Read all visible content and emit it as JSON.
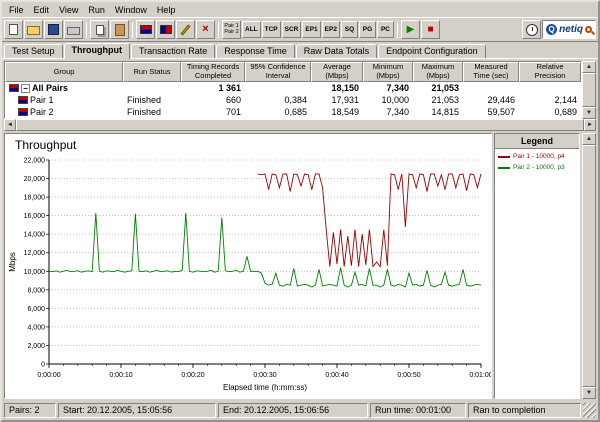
{
  "menubar": {
    "items": [
      "File",
      "Edit",
      "View",
      "Run",
      "Window",
      "Help"
    ]
  },
  "toolbar": {
    "filter_buttons": [
      "ALL",
      "TCP",
      "SCR",
      "EP1",
      "EP2",
      "SQ",
      "PG",
      "PC"
    ],
    "pair_buttons": [
      "Pair 1",
      "Pair 2"
    ],
    "logo_text": "netiq"
  },
  "tabs": {
    "items": [
      "Test Setup",
      "Throughput",
      "Transaction Rate",
      "Response Time",
      "Raw Data Totals",
      "Endpoint Configuration"
    ],
    "active": "Throughput"
  },
  "table": {
    "columns": [
      "Group",
      "Run Status",
      "Timing Records\nCompleted",
      "95% Confidence\nInterval",
      "Average\n(Mbps)",
      "Minimum\n(Mbps)",
      "Maximum\n(Mbps)",
      "Measured\nTime (sec)",
      "Relative\nPrecision"
    ],
    "rows": [
      {
        "group": "All Pairs",
        "status": "",
        "records": "1 361",
        "ci": "",
        "avg": "18,150",
        "min": "7,340",
        "max": "21,053",
        "time": "",
        "prec": ""
      },
      {
        "group": "Pair 1",
        "status": "Finished",
        "records": "660",
        "ci": "0,384",
        "avg": "17,931",
        "min": "10,000",
        "max": "21,053",
        "time": "29,446",
        "prec": "2,144"
      },
      {
        "group": "Pair 2",
        "status": "Finished",
        "records": "701",
        "ci": "0,685",
        "avg": "18,549",
        "min": "7,340",
        "max": "14,815",
        "time": "59,507",
        "prec": "0,689"
      }
    ]
  },
  "legend": {
    "title": "Legend",
    "items": [
      {
        "label": "Pair 1 - 10000, p4",
        "color": "#990000"
      },
      {
        "label": "Pair 2 - 10000, p3",
        "color": "#008000"
      }
    ]
  },
  "statusbar": {
    "cells": [
      "Pairs: 2",
      "Start: 20.12.2005, 15:05:56",
      "End: 20.12.2005, 15:06:56",
      "Run time: 00:01:00",
      "Ran to completion"
    ]
  },
  "colors": {
    "window_bg": "#d4d0c8",
    "pair1": "#990000",
    "pair2": "#008000"
  },
  "chart_data": {
    "type": "line",
    "title": "Throughput",
    "xlabel": "Elapsed time (h:mm:ss)",
    "ylabel": "Mbps",
    "xlim": [
      0,
      60
    ],
    "ylim": [
      0,
      22000
    ],
    "ytick_step": 2000,
    "ytick_labels": [
      "0",
      "2,000",
      "4,000",
      "6,000",
      "8,000",
      "10,000",
      "12,000",
      "14,000",
      "16,000",
      "18,000",
      "20,000",
      "22,000"
    ],
    "xtick_values": [
      0,
      10,
      20,
      30,
      40,
      50,
      60
    ],
    "xtick_labels": [
      "0:00:00",
      "0:00:10",
      "0:00:20",
      "0:00:30",
      "0:00:40",
      "0:00:50",
      "0:01:00"
    ],
    "minor_xtick_step": 2,
    "grid": "horizontal-dotted",
    "legend_position": "right-panel",
    "series": [
      {
        "name": "Pair 1 - 10000, p4",
        "color": "#990000",
        "t0": 29,
        "dt": 0.5,
        "values": [
          20500,
          20400,
          20500,
          18800,
          20500,
          20400,
          19000,
          20500,
          20500,
          18600,
          20500,
          20400,
          19200,
          20500,
          20400,
          18800,
          20500,
          20500,
          19000,
          14500,
          10500,
          14200,
          10800,
          14500,
          10500,
          13800,
          10600,
          14500,
          10500,
          14000,
          10700,
          14500,
          10500,
          11000,
          10500,
          14500,
          10600,
          20500,
          20400,
          18800,
          20500,
          14800,
          20500,
          20400,
          19000,
          20500,
          20400,
          18600,
          20500,
          20500,
          19200,
          20400,
          18800,
          20500,
          20500,
          19000,
          20400,
          20500,
          18700,
          20500,
          20400,
          19000,
          20500
        ]
      },
      {
        "name": "Pair 2 - 10000, p3",
        "color": "#008000",
        "t0": 0,
        "dt": 0.5,
        "values": [
          10000,
          9950,
          10050,
          9900,
          10000,
          10100,
          9950,
          10000,
          10050,
          9900,
          10000,
          10050,
          9950,
          16300,
          10000,
          9900,
          10050,
          10000,
          9950,
          10100,
          10000,
          9900,
          10000,
          10050,
          16200,
          10000,
          9950,
          10050,
          9900,
          10000,
          10100,
          9950,
          10000,
          10050,
          9900,
          10000,
          9950,
          10100,
          16300,
          10000,
          9900,
          10050,
          10000,
          9950,
          10000,
          10100,
          9900,
          10000,
          15800,
          10050,
          9950,
          10000,
          10100,
          9900,
          10000,
          11600,
          10000,
          9950,
          10000,
          9800,
          8700,
          8500,
          8600,
          9800,
          8500,
          8400,
          8600,
          8500,
          10300,
          8400,
          8500,
          8600,
          8500,
          8300,
          8500,
          10200,
          8400,
          8500,
          8600,
          8500,
          8400,
          10400,
          8500,
          8300,
          8500,
          9900,
          8500,
          8600,
          8400,
          10300,
          8500,
          8500,
          8300,
          8500,
          10200,
          8500,
          8400,
          8600,
          8500,
          8300,
          9800,
          8500,
          8600,
          8400,
          8500,
          10100,
          8500,
          8300,
          8500,
          8600,
          9900,
          8500,
          8400,
          8500,
          8600,
          10200,
          8500,
          8400,
          8500,
          8600,
          8500
        ]
      }
    ]
  }
}
